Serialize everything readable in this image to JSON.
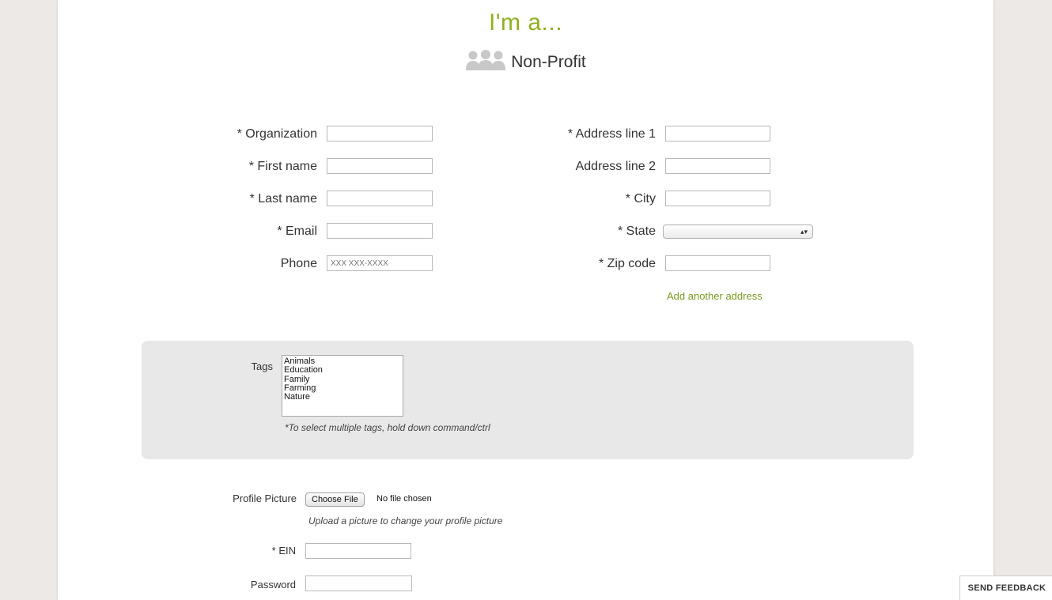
{
  "header": {
    "title": "I'm a...",
    "role": "Non-Profit"
  },
  "left_fields": [
    {
      "label": "* Organization",
      "value": "",
      "placeholder": ""
    },
    {
      "label": "* First name",
      "value": "",
      "placeholder": ""
    },
    {
      "label": "* Last name",
      "value": "",
      "placeholder": ""
    },
    {
      "label": "* Email",
      "value": "",
      "placeholder": ""
    },
    {
      "label": "Phone",
      "value": "",
      "placeholder": "XXX XXX-XXXX"
    }
  ],
  "right_fields": [
    {
      "label": "* Address line 1",
      "value": "",
      "placeholder": ""
    },
    {
      "label": "Address line 2",
      "value": "",
      "placeholder": ""
    },
    {
      "label": "* City",
      "value": "",
      "placeholder": ""
    },
    {
      "label": "* State",
      "value": ""
    },
    {
      "label": "* Zip code",
      "value": "",
      "placeholder": ""
    }
  ],
  "add_address_link": "Add another address",
  "tags": {
    "label": "Tags",
    "options": [
      "Animals",
      "Education",
      "Family",
      "Farming",
      "Nature"
    ],
    "hint": "*To select multiple tags, hold down command/ctrl"
  },
  "profile_picture": {
    "label": "Profile Picture",
    "button": "Choose File",
    "status": "No file chosen",
    "hint": "Upload a picture to change your profile picture"
  },
  "ein": {
    "label": "* EIN",
    "value": ""
  },
  "password": {
    "label": "Password",
    "value": ""
  },
  "feedback_button": "SEND FEEDBACK",
  "colors": {
    "accent": "#8fb020",
    "link": "#7a9a1e",
    "background": "#ece9e7",
    "panel": "#e8e8e8"
  }
}
